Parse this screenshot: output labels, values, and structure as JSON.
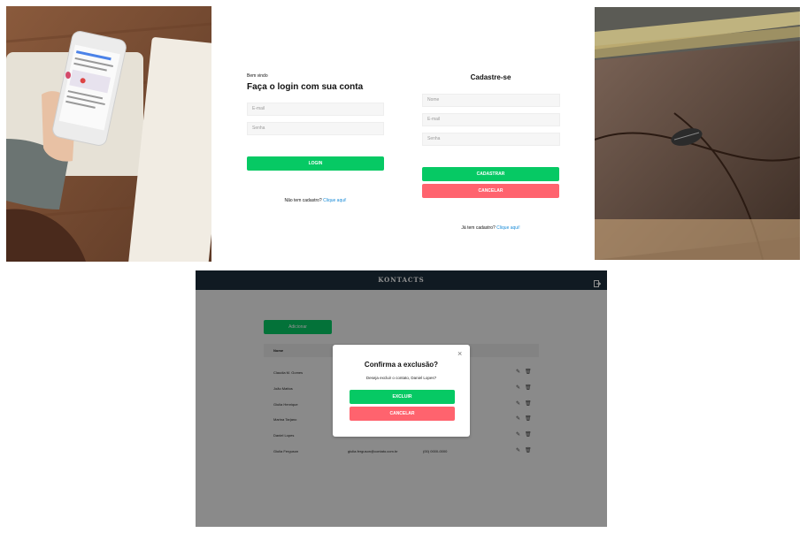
{
  "login": {
    "welcome": "Bem vindo",
    "title": "Faça o login com sua conta",
    "email_placeholder": "E-mail",
    "password_placeholder": "Senha",
    "login_button": "LOGIN",
    "no_account_text": "Não tem cadastro?",
    "no_account_link": "Clique aqui!"
  },
  "signup": {
    "title": "Cadastre-se",
    "name_placeholder": "Nome",
    "email_placeholder": "E-mail",
    "password_placeholder": "Senha",
    "register_button": "CADASTRAR",
    "cancel_button": "CANCELAR",
    "has_account_text": "Já tem cadastro?",
    "has_account_link": "Clique aqui!"
  },
  "app": {
    "title": "KONTACTS",
    "add_button": "Adicionar",
    "table_header_name": "Nome",
    "rows": [
      {
        "name": "Claudia M. Gomes",
        "email": "",
        "phone": ""
      },
      {
        "name": "João Mattos",
        "email": "",
        "phone": ""
      },
      {
        "name": "Giulia Henrique",
        "email": "",
        "phone": ""
      },
      {
        "name": "Marina Tarjano",
        "email": "",
        "phone": ""
      },
      {
        "name": "Daniel Lopes",
        "email": "",
        "phone": ""
      },
      {
        "name": "Giulia Ferguson",
        "email": "giulia.ferguson@contato.com.br",
        "phone": "(00) 0000-0000"
      }
    ],
    "colors": {
      "header": "#1d2e3c",
      "green": "#06c964",
      "red": "#ff636e"
    }
  },
  "modal": {
    "title": "Confirma a exclusão?",
    "question": "Deseja excluir o contato, Daniel Lopes?",
    "confirm_button": "EXCLUIR",
    "cancel_button": "CANCELAR"
  }
}
